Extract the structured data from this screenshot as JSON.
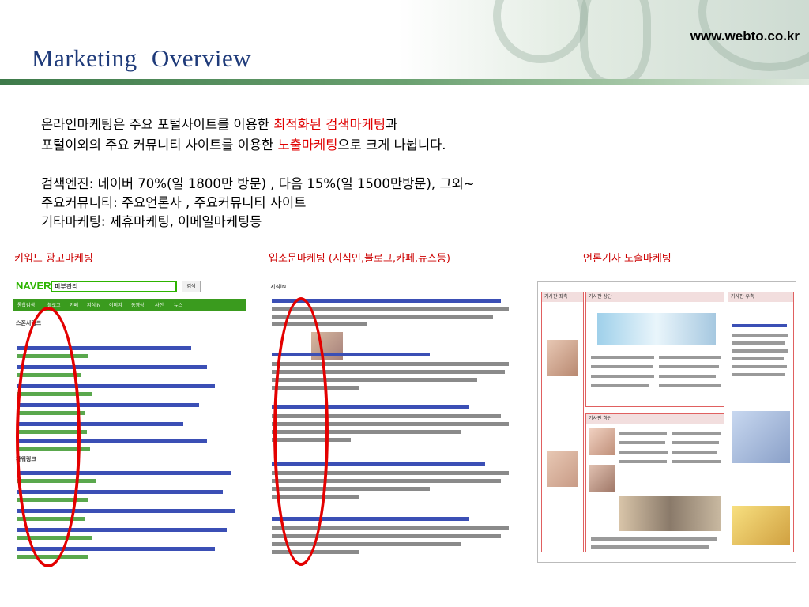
{
  "header": {
    "url": "www.webto.co.kr",
    "title": "Marketing  Overview"
  },
  "intro": {
    "line1_pre": "온라인마케팅은 주요 포털사이트를 이용한 ",
    "line1_red": "최적화된 검색마케팅",
    "line1_post": "과",
    "line2_pre": "포털이외의 주요 커뮤니티 사이트를 이용한  ",
    "line2_red": "노출마케팅",
    "line2_post": "으로 크게 나뉩니다."
  },
  "details": {
    "line1": "검색엔진: 네이버 70%(일 1800만 방문) , 다음 15%(일 1500만방문), 그외~",
    "line2": "주요커뮤니티: 주요언론사 , 주요커뮤니티 사이트",
    "line3": "기타마케팅: 제휴마케팅, 이메일마케팅등"
  },
  "columns": {
    "keyword_label": "키워드 광고마케팅",
    "viral_label": "입소문마케팅 (지식인,블로그,카페,뉴스등)",
    "news_label": "언론기사 노출마케팅"
  },
  "naver_shot": {
    "logo": "NAVER",
    "query": "피부관리",
    "search_btn": "검색",
    "tabs": [
      "통합검색",
      "블로그",
      "카페",
      "지식iN",
      "이미지",
      "동영상",
      "사전",
      "뉴스"
    ],
    "sponsor_heading": "스폰서링크",
    "power_heading": "파워링크"
  },
  "blog_shot": {
    "heading": "지식iN"
  },
  "news_shot": {
    "col_heads": [
      "기사판 좌측",
      "기사판 상단",
      "기사판 우측"
    ],
    "mid_head": "기사판 하단"
  },
  "colors": {
    "title": "#1f3b7a",
    "accent_red": "#e00000",
    "naver_green": "#2db400",
    "header_bar": "#3e7a4a"
  }
}
